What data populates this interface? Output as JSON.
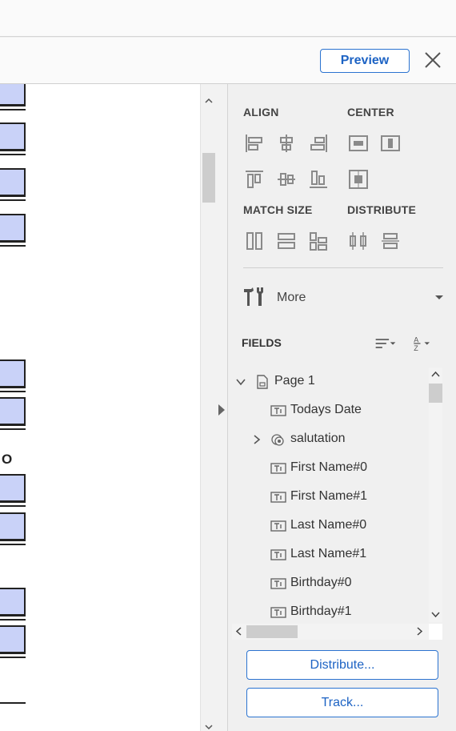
{
  "toolbar": {
    "preview_label": "Preview"
  },
  "panel": {
    "align_title": "ALIGN",
    "center_title": "CENTER",
    "match_size_title": "MATCH SIZE",
    "distribute_title": "DISTRIBUTE",
    "more_label": "More",
    "fields_title": "FIELDS"
  },
  "document": {
    "visible_letter": "O"
  },
  "tree": {
    "items": [
      {
        "label": "Page 1"
      },
      {
        "label": "Todays Date"
      },
      {
        "label": "salutation"
      },
      {
        "label": "First Name#0"
      },
      {
        "label": "First Name#1"
      },
      {
        "label": "Last Name#0"
      },
      {
        "label": "Last Name#1"
      },
      {
        "label": "Birthday#0"
      },
      {
        "label": "Birthday#1"
      }
    ]
  },
  "buttons": {
    "distribute_label": "Distribute...",
    "track_label": "Track..."
  },
  "colors": {
    "accent": "#1d63c4",
    "field_fill": "#c9d2f8",
    "icon_gray": "#8a8a8a"
  }
}
